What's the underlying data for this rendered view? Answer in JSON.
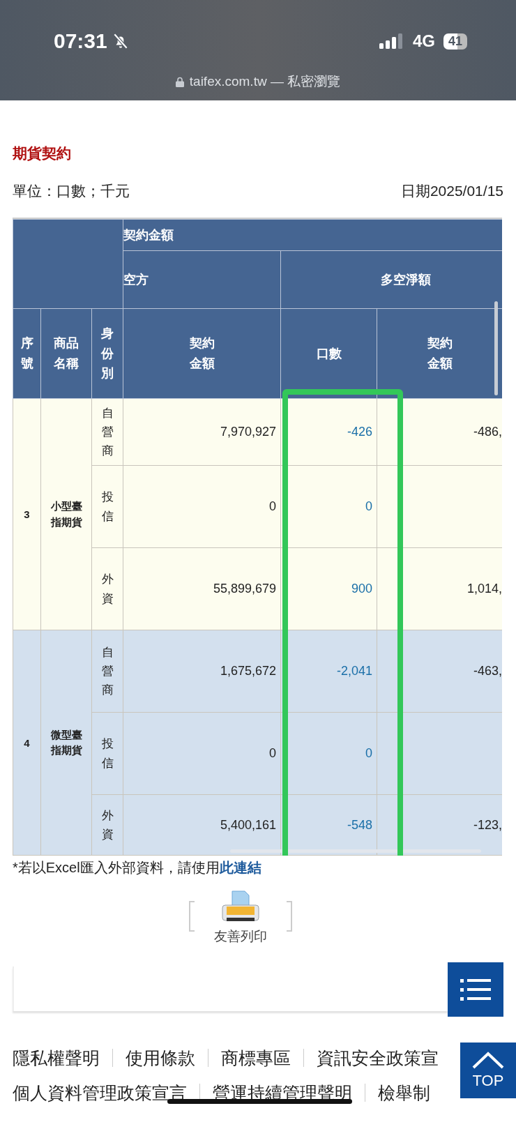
{
  "status_bar": {
    "time": "07:31",
    "network": "4G",
    "battery": "41"
  },
  "browser": {
    "address": "taifex.com.tw — 私密瀏覽"
  },
  "title": "期貨契約",
  "unit": "單位：口數；千元",
  "date": "日期2025/01/15",
  "table": {
    "group_header": "契約金額",
    "subheaders": [
      "空方",
      "多空淨額"
    ],
    "columns": [
      "序號",
      "商品名稱",
      "身份別",
      "契約金額",
      "口數",
      "契約金額"
    ],
    "groups": [
      {
        "index": "3",
        "product": "小型臺指期貨",
        "rows": [
          {
            "identity": "自營商",
            "amount": "7,970,927",
            "lots": "-426",
            "net_amount": "-486,"
          },
          {
            "identity": "投信",
            "amount": "0",
            "lots": "0",
            "net_amount": ""
          },
          {
            "identity": "外資",
            "amount": "55,899,679",
            "lots": "900",
            "net_amount": "1,014,"
          }
        ]
      },
      {
        "index": "4",
        "product": "微型臺指期貨",
        "rows": [
          {
            "identity": "自營商",
            "amount": "1,675,672",
            "lots": "-2,041",
            "net_amount": "-463,"
          },
          {
            "identity": "投信",
            "amount": "0",
            "lots": "0",
            "net_amount": ""
          },
          {
            "identity": "外資",
            "amount": "5,400,161",
            "lots": "-548",
            "net_amount": "-123,"
          }
        ]
      }
    ]
  },
  "footnote": {
    "text": "*若以Excel匯入外部資料，請使用",
    "link": "此連結"
  },
  "print_button": "友善列印",
  "footer_links": [
    [
      "隱私權聲明",
      "使用條款",
      "商標專區",
      "資訊安全政策宣"
    ],
    [
      "個人資料管理政策宣言",
      "營運持續管理聲明",
      "檢舉制"
    ]
  ],
  "top_button": "TOP"
}
